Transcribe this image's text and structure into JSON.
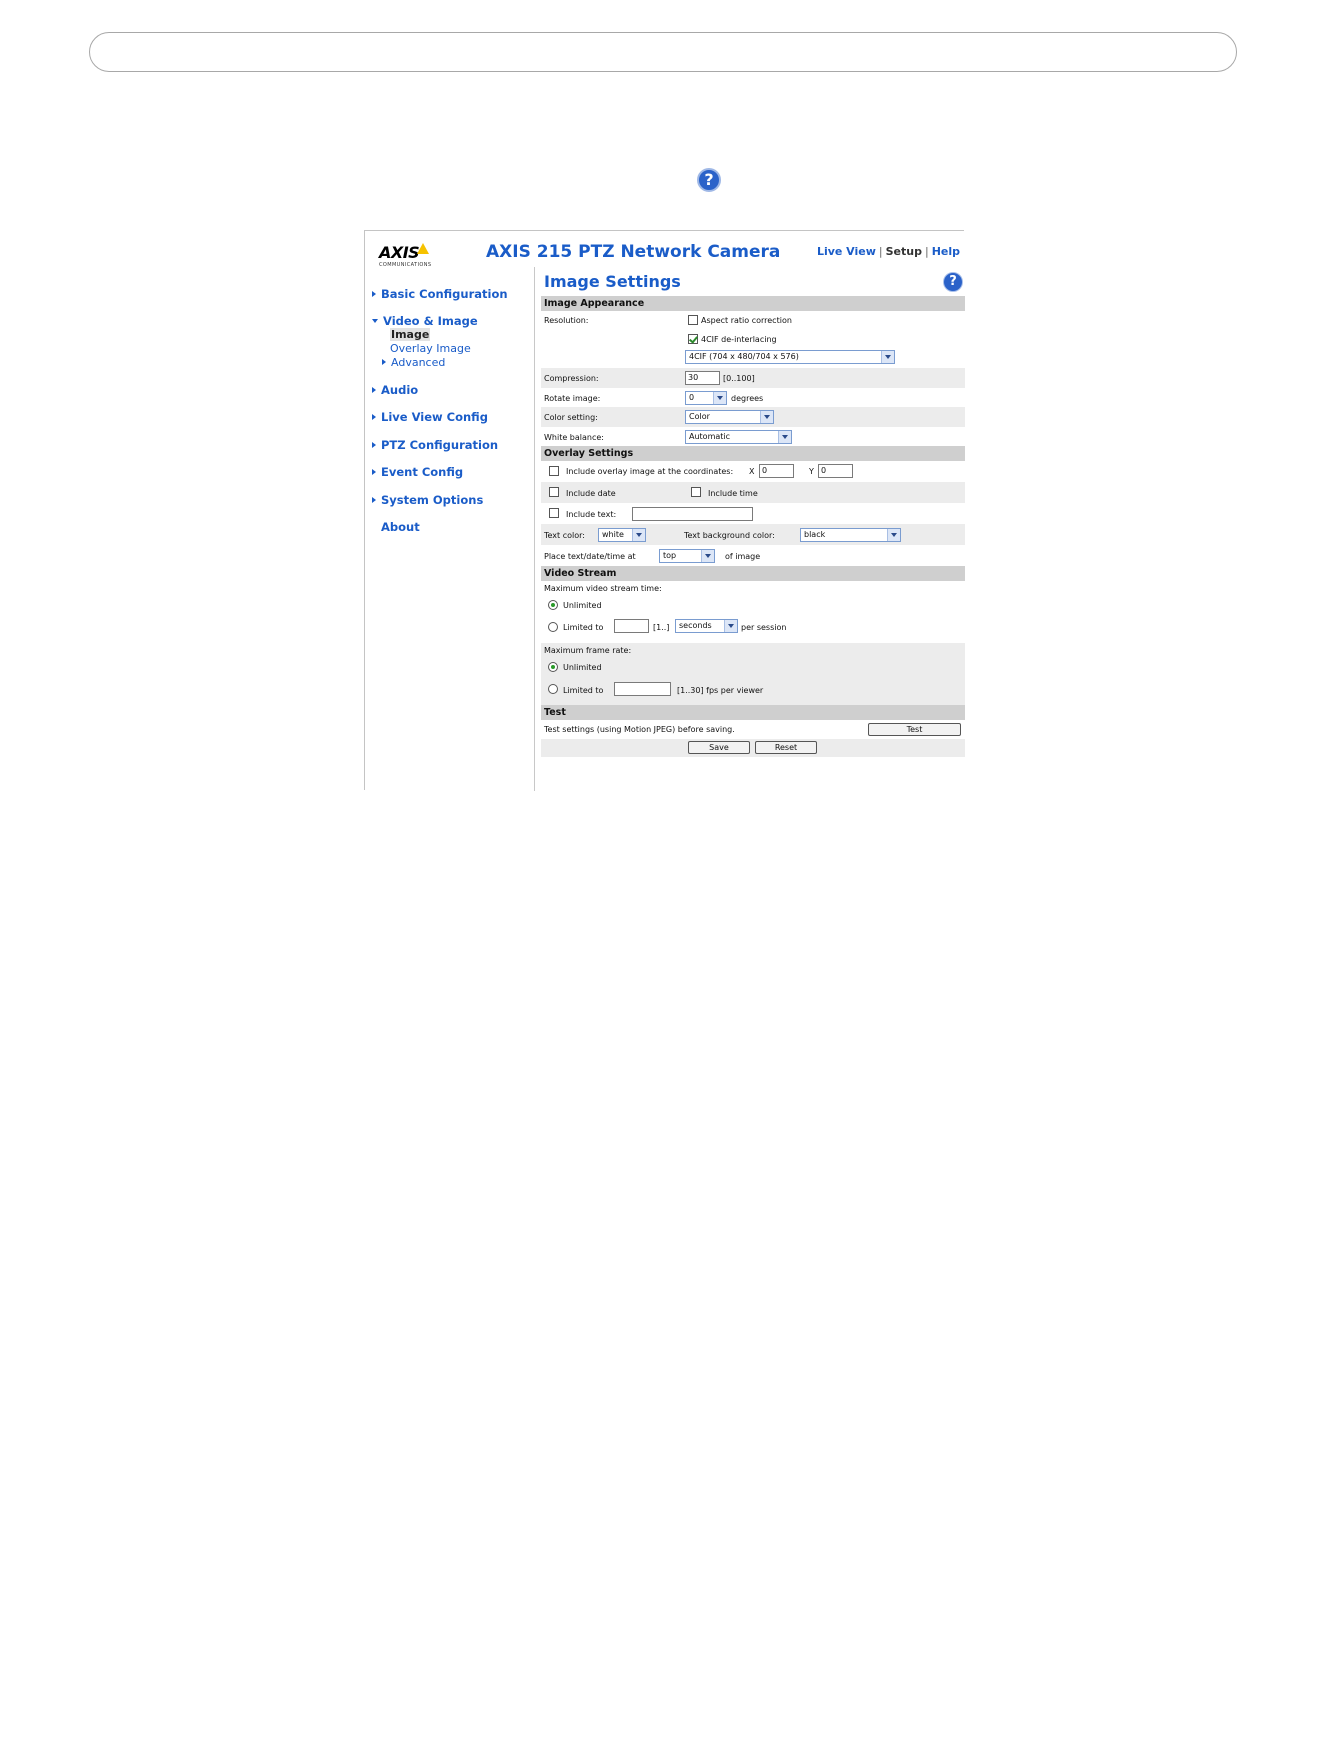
{
  "document": {
    "help_icon_glyph": "?"
  },
  "camera_ui": {
    "logo": {
      "text": "AXIS",
      "tagline": "COMMUNICATIONS"
    },
    "title": "AXIS 215 PTZ Network Camera",
    "top_nav": {
      "live_view": "Live View",
      "setup": "Setup",
      "help": "Help",
      "separator": "|"
    },
    "help_glyph": "?",
    "sidebar": {
      "basic_configuration": "Basic Configuration",
      "video_image": "Video & Image",
      "image": "Image",
      "overlay_image": "Overlay Image",
      "advanced": "Advanced",
      "audio": "Audio",
      "live_view_config": "Live View Config",
      "ptz_configuration": "PTZ Configuration",
      "event_config": "Event Config",
      "system_options": "System Options",
      "about": "About"
    },
    "page_title": "Image Settings",
    "image_appearance": {
      "header": "Image Appearance",
      "resolution_label": "Resolution:",
      "aspect_ratio_label": "Aspect ratio correction",
      "aspect_ratio_checked": false,
      "deinterlacing_label": "4CIF de-interlacing",
      "deinterlacing_checked": true,
      "resolution_value": "4CIF (704 x 480/704 x 576)",
      "compression_label": "Compression:",
      "compression_value": "30",
      "compression_range": "[0..100]",
      "rotate_label": "Rotate image:",
      "rotate_value": "0",
      "rotate_unit": "degrees",
      "color_label": "Color setting:",
      "color_value": "Color",
      "white_balance_label": "White balance:",
      "white_balance_value": "Automatic"
    },
    "overlay_settings": {
      "header": "Overlay Settings",
      "include_overlay_label": "Include overlay image at the coordinates:",
      "x_label": "X",
      "x_value": "0",
      "y_label": "Y",
      "y_value": "0",
      "include_date_label": "Include date",
      "include_time_label": "Include time",
      "include_text_label": "Include text:",
      "include_text_value": "",
      "text_color_label": "Text color:",
      "text_color_value": "white",
      "text_bg_label": "Text background color:",
      "text_bg_value": "black",
      "place_label": "Place text/date/time at",
      "place_value": "top",
      "place_suffix": "of image"
    },
    "video_stream": {
      "header": "Video Stream",
      "max_time_label": "Maximum video stream time:",
      "unlimited_label": "Unlimited",
      "limited_to_label": "Limited to",
      "limited_time_value": "",
      "limited_time_range": "[1..]",
      "time_unit_value": "seconds",
      "per_session": "per session",
      "max_frame_label": "Maximum frame rate:",
      "frame_unlimited_label": "Unlimited",
      "frame_limited_label": "Limited to",
      "frame_limited_value": "",
      "frame_range": "[1..30] fps per viewer"
    },
    "test": {
      "header": "Test",
      "description": "Test settings (using Motion JPEG) before saving.",
      "test_button": "Test",
      "save_button": "Save",
      "reset_button": "Reset"
    }
  }
}
